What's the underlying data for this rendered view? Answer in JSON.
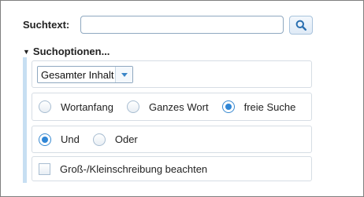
{
  "search": {
    "label": "Suchtext:",
    "value": "",
    "placeholder": "",
    "button_icon": "search-icon"
  },
  "options": {
    "header": "Suchoptionen...",
    "expanded": true,
    "scope": {
      "selected": "Gesamter Inhalt"
    },
    "match_mode": {
      "items": [
        "Wortanfang",
        "Ganzes Wort",
        "freie Suche"
      ],
      "selected": "freie Suche"
    },
    "logic": {
      "items": [
        "Und",
        "Oder"
      ],
      "selected": "Und"
    },
    "case_sensitive": {
      "label": "Groß-/Kleinschreibung beachten",
      "checked": false
    }
  },
  "colors": {
    "accent": "#2f86d6",
    "option_bar": "#c7dff2",
    "panel_border": "#d6dde4"
  }
}
